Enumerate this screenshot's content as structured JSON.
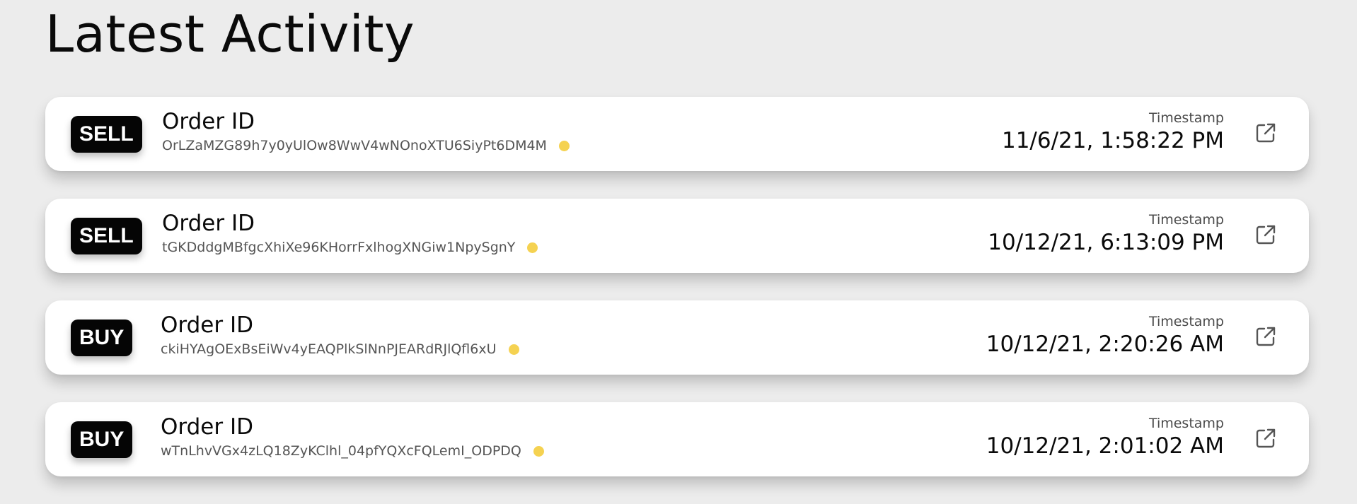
{
  "page": {
    "title": "Latest Activity"
  },
  "colors": {
    "status_dot": "#f5d251",
    "badge_bg": "#050505",
    "card_bg": "#ffffff",
    "page_bg": "#ececec"
  },
  "activity": [
    {
      "side": "SELL",
      "order_label": "Order ID",
      "order_id": "OrLZaMZG89h7y0yUlOw8WwV4wNOnoXTU6SiyPt6DM4M",
      "timestamp_label": "Timestamp",
      "timestamp": "11/6/21, 1:58:22 PM",
      "link_icon": "external-link-icon"
    },
    {
      "side": "SELL",
      "order_label": "Order ID",
      "order_id": "tGKDddgMBfgcXhiXe96KHorrFxlhogXNGiw1NpySgnY",
      "timestamp_label": "Timestamp",
      "timestamp": "10/12/21, 6:13:09 PM",
      "link_icon": "external-link-icon"
    },
    {
      "side": "BUY",
      "order_label": "Order ID",
      "order_id": "ckiHYAgOExBsEiWv4yEAQPlkSlNnPJEARdRJlQfl6xU",
      "timestamp_label": "Timestamp",
      "timestamp": "10/12/21, 2:20:26 AM",
      "link_icon": "external-link-icon"
    },
    {
      "side": "BUY",
      "order_label": "Order ID",
      "order_id": "wTnLhvVGx4zLQ18ZyKClhl_04pfYQXcFQLemI_ODPDQ",
      "timestamp_label": "Timestamp",
      "timestamp": "10/12/21, 2:01:02 AM",
      "link_icon": "external-link-icon"
    }
  ]
}
